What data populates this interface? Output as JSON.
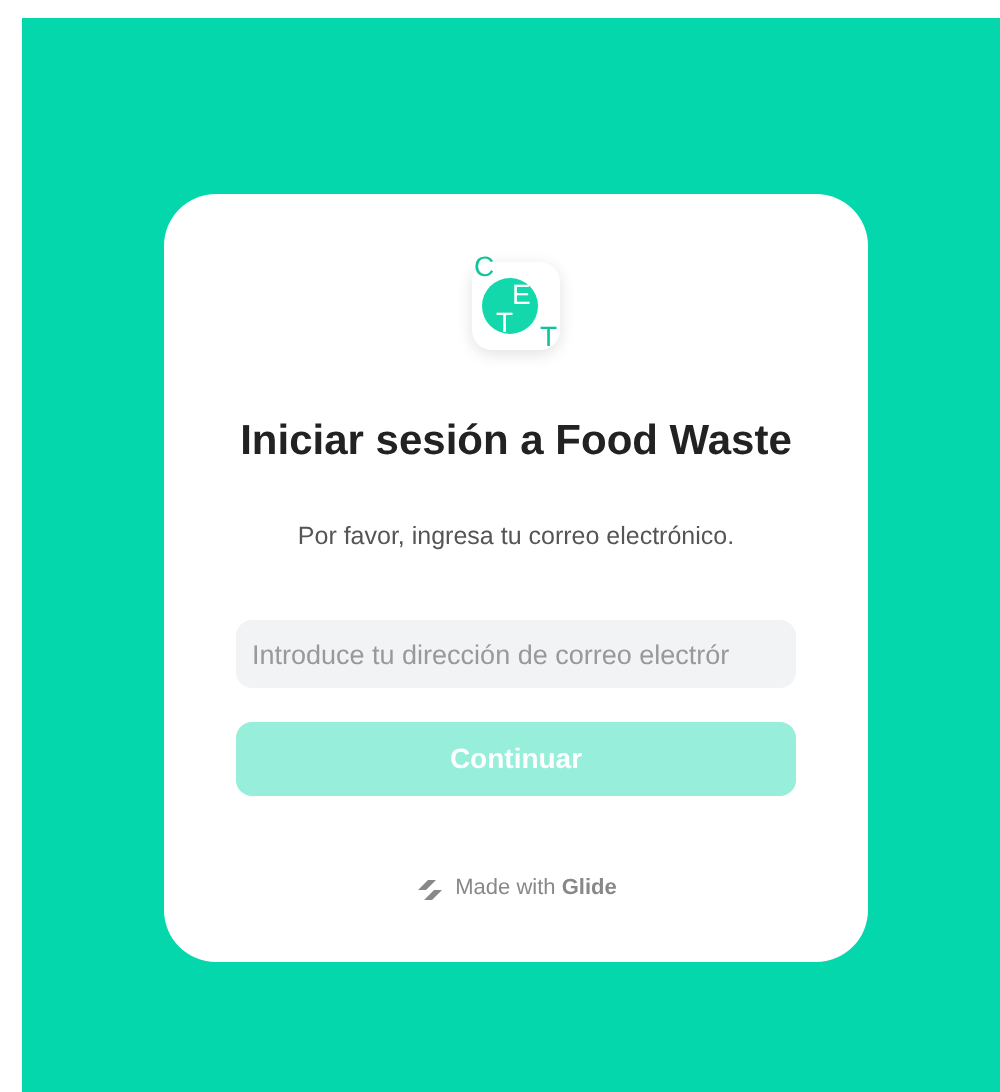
{
  "logo": {
    "letters": [
      "C",
      "E",
      "T",
      "T"
    ]
  },
  "title": "Iniciar sesión a Food Waste",
  "subtitle": "Por favor, ingresa tu correo electrónico.",
  "email": {
    "placeholder": "Introduce tu dirección de correo electrór"
  },
  "continue_button": {
    "label": "Continuar",
    "disabled": true
  },
  "footer": "Made with **Glide**"
}
